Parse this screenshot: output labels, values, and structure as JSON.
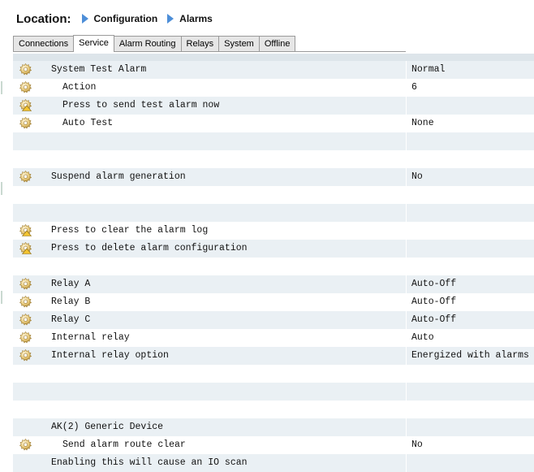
{
  "location": {
    "label": "Location:",
    "crumbs": [
      "Configuration",
      "Alarms"
    ]
  },
  "tabs": [
    {
      "label": "Connections",
      "active": false
    },
    {
      "label": "Service",
      "active": true
    },
    {
      "label": "Alarm Routing",
      "active": false
    },
    {
      "label": "Relays",
      "active": false
    },
    {
      "label": "System",
      "active": false
    },
    {
      "label": "Offline",
      "active": false
    }
  ],
  "rows": {
    "system_test_alarm": {
      "label": "System Test Alarm",
      "value": "Normal",
      "icon": "gear-icon"
    },
    "action": {
      "label": "Action",
      "value": "6",
      "icon": "gear-icon"
    },
    "send_test_alarm": {
      "label": "Press to send test alarm now",
      "icon": "gear-warning-icon"
    },
    "auto_test": {
      "label": "Auto Test",
      "value": "None",
      "icon": "gear-icon"
    },
    "suspend_alarm": {
      "label": "Suspend alarm generation",
      "value": "No",
      "icon": "gear-icon"
    },
    "clear_alarm_log": {
      "label": "Press to clear the alarm log",
      "icon": "gear-warning-icon"
    },
    "delete_alarm_config": {
      "label": "Press to delete alarm configuration",
      "icon": "gear-warning-icon"
    },
    "relay_a": {
      "label": "Relay A",
      "value": "Auto-Off",
      "icon": "gear-icon"
    },
    "relay_b": {
      "label": "Relay B",
      "value": "Auto-Off",
      "icon": "gear-icon"
    },
    "relay_c": {
      "label": "Relay C",
      "value": "Auto-Off",
      "icon": "gear-icon"
    },
    "internal_relay": {
      "label": "Internal relay",
      "value": "Auto",
      "icon": "gear-icon"
    },
    "internal_relay_option": {
      "label": "Internal relay option",
      "value": "Energized with alarms",
      "icon": "gear-icon"
    },
    "generic_device": {
      "label": "AK(2) Generic Device"
    },
    "send_alarm_route_clear": {
      "label": "Send alarm route clear",
      "value": "No",
      "icon": "gear-icon"
    },
    "io_scan_note": {
      "label": "Enabling this will cause an IO scan"
    }
  },
  "colors": {
    "row_shade": "#eaf0f4",
    "band": "#dde5ea",
    "breadcrumb_arrow": "#4d8ed8",
    "icon_gold": "#d8b04a"
  }
}
